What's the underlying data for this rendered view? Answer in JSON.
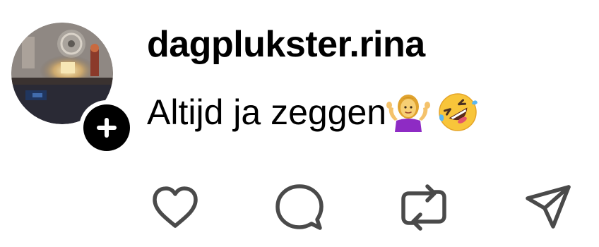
{
  "post": {
    "username": "dagplukster.rina",
    "caption_text": "Altijd ja zeggen",
    "caption_emojis": [
      "woman-shrugging-emoji",
      "rolling-on-floor-laughing-emoji"
    ]
  },
  "avatar": {
    "follow_icon": "plus-icon"
  },
  "actions": [
    {
      "name": "like-button",
      "icon": "heart-icon"
    },
    {
      "name": "comment-button",
      "icon": "speech-bubble-icon"
    },
    {
      "name": "repost-button",
      "icon": "repost-icon"
    },
    {
      "name": "share-button",
      "icon": "paper-plane-icon"
    }
  ],
  "colors": {
    "text": "#000000",
    "icon": "#4a4a4a",
    "background": "#ffffff"
  }
}
